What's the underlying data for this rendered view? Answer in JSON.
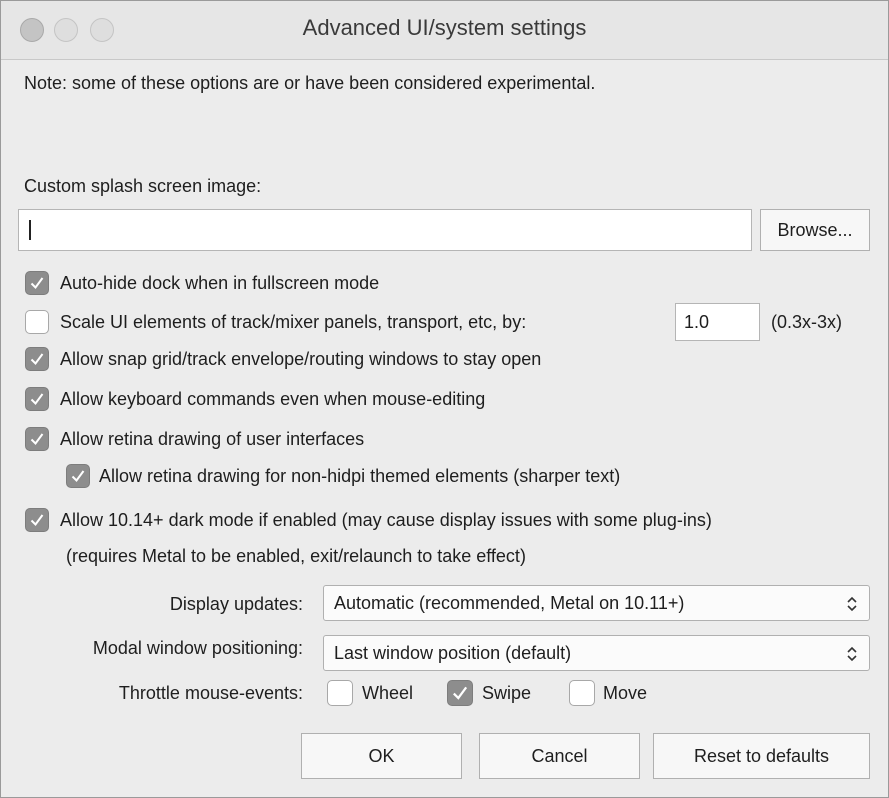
{
  "window": {
    "title": "Advanced UI/system settings"
  },
  "note": "Note: some of these options are or have been considered experimental.",
  "splash": {
    "label": "Custom splash screen image:",
    "value": "",
    "browse_label": "Browse..."
  },
  "options": {
    "autohide_dock": {
      "label": "Auto-hide dock when in fullscreen mode",
      "checked": true
    },
    "scale_ui": {
      "label": "Scale UI elements of track/mixer panels, transport, etc, by:",
      "checked": false,
      "value": "1.0",
      "range": "(0.3x-3x)"
    },
    "snap_grid": {
      "label": "Allow snap grid/track envelope/routing windows to stay open",
      "checked": true
    },
    "keyboard_cmds": {
      "label": "Allow keyboard commands even when mouse-editing",
      "checked": true
    },
    "retina": {
      "label": "Allow retina drawing of user interfaces",
      "checked": true
    },
    "retina_nonhidpi": {
      "label": "Allow retina drawing for non-hidpi themed elements (sharper text)",
      "checked": true
    },
    "dark_mode": {
      "label": "Allow 10.14+ dark mode if enabled (may cause display issues with some plug-ins)",
      "checked": true
    },
    "dark_mode_note": "(requires Metal to be enabled, exit/relaunch to take effect)"
  },
  "display_updates": {
    "label": "Display updates:",
    "value": "Automatic (recommended, Metal on 10.11+)"
  },
  "modal_positioning": {
    "label": "Modal window positioning:",
    "value": "Last window position (default)"
  },
  "throttle": {
    "label": "Throttle mouse-events:",
    "wheel": {
      "label": "Wheel",
      "checked": false
    },
    "swipe": {
      "label": "Swipe",
      "checked": true
    },
    "move": {
      "label": "Move",
      "checked": false
    }
  },
  "buttons": {
    "ok": "OK",
    "cancel": "Cancel",
    "reset": "Reset to defaults"
  },
  "colors": {
    "window_bg": "#ececec",
    "checkbox_on": "#8d8d8d"
  }
}
